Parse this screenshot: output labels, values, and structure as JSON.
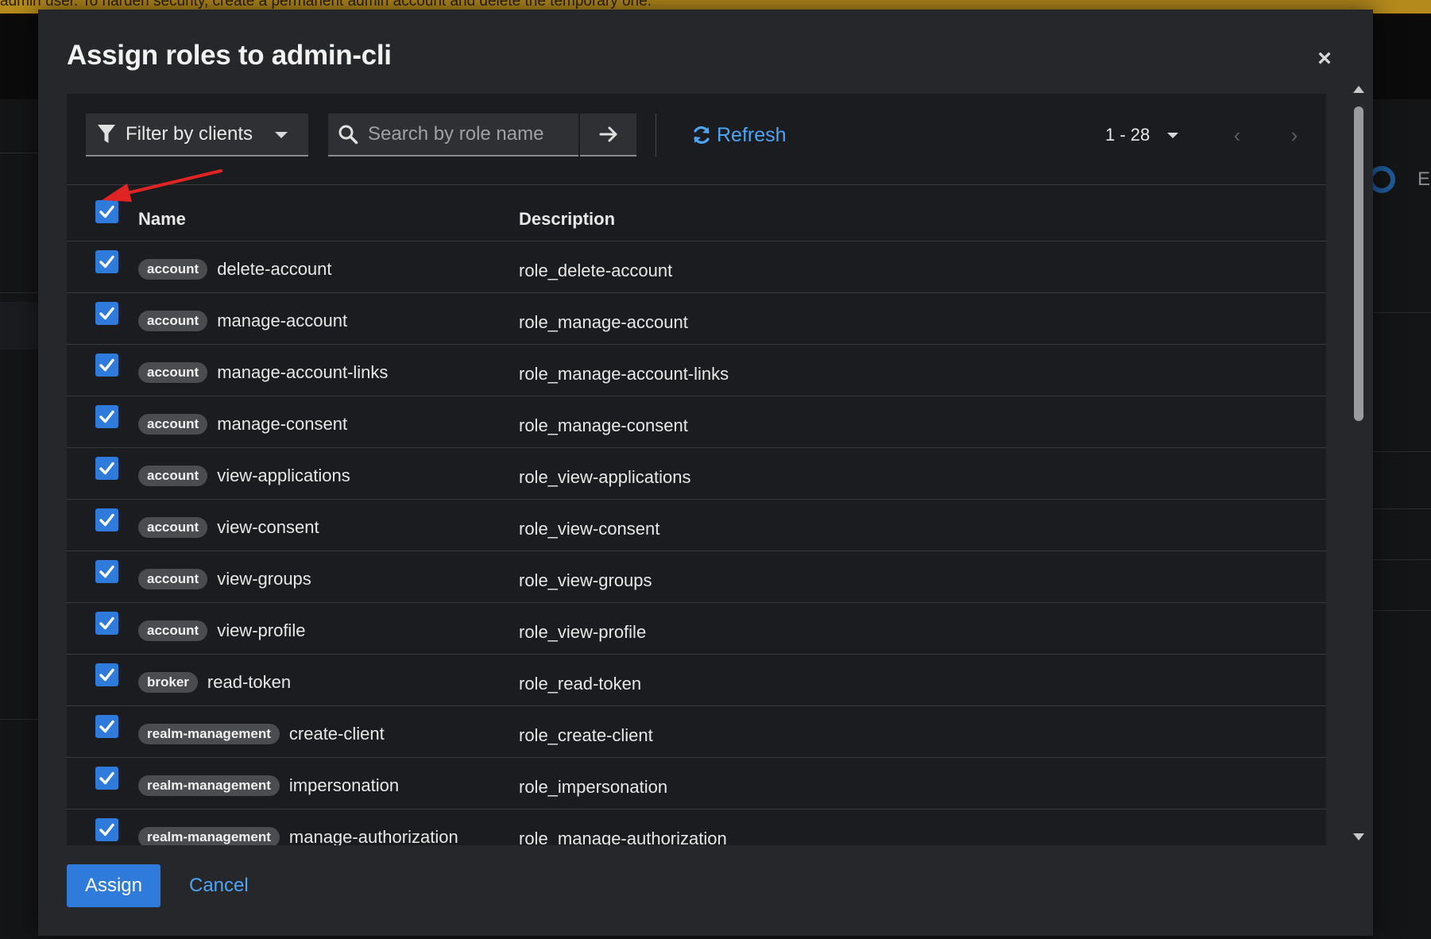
{
  "banner": {
    "text": "admin user. To harden security, create a permanent admin account and delete the temporary one."
  },
  "modal": {
    "title": "Assign roles to admin-cli",
    "close_glyph": "×"
  },
  "toolbar": {
    "filter_label": "Filter by clients",
    "search_placeholder": "Search by role name",
    "refresh_label": "Refresh",
    "pagination_range": "1 - 28"
  },
  "table": {
    "columns": {
      "name": "Name",
      "description": "Description"
    },
    "rows": [
      {
        "client": "account",
        "role": "delete-account",
        "description": "role_delete-account",
        "checked": true
      },
      {
        "client": "account",
        "role": "manage-account",
        "description": "role_manage-account",
        "checked": true
      },
      {
        "client": "account",
        "role": "manage-account-links",
        "description": "role_manage-account-links",
        "checked": true
      },
      {
        "client": "account",
        "role": "manage-consent",
        "description": "role_manage-consent",
        "checked": true
      },
      {
        "client": "account",
        "role": "view-applications",
        "description": "role_view-applications",
        "checked": true
      },
      {
        "client": "account",
        "role": "view-consent",
        "description": "role_view-consent",
        "checked": true
      },
      {
        "client": "account",
        "role": "view-groups",
        "description": "role_view-groups",
        "checked": true
      },
      {
        "client": "account",
        "role": "view-profile",
        "description": "role_view-profile",
        "checked": true
      },
      {
        "client": "broker",
        "role": "read-token",
        "description": "role_read-token",
        "checked": true
      },
      {
        "client": "realm-management",
        "role": "create-client",
        "description": "role_create-client",
        "checked": true
      },
      {
        "client": "realm-management",
        "role": "impersonation",
        "description": "role_impersonation",
        "checked": true
      },
      {
        "client": "realm-management",
        "role": "manage-authorization",
        "description": "role_manage-authorization",
        "checked": true
      }
    ]
  },
  "footer": {
    "assign_label": "Assign",
    "cancel_label": "Cancel"
  },
  "background": {
    "partial_letter": "E"
  },
  "colors": {
    "accent": "#2f7bdc",
    "link": "#4ea4f5",
    "annotation": "#e02424",
    "banner": "#b48a1c"
  },
  "icons": {
    "filter": "funnel-icon",
    "search": "search-icon",
    "submit": "arrow-right-icon",
    "refresh": "refresh-icon",
    "close": "close-icon",
    "checkbox": "check-icon",
    "annotation": "red-arrow-annotation"
  }
}
